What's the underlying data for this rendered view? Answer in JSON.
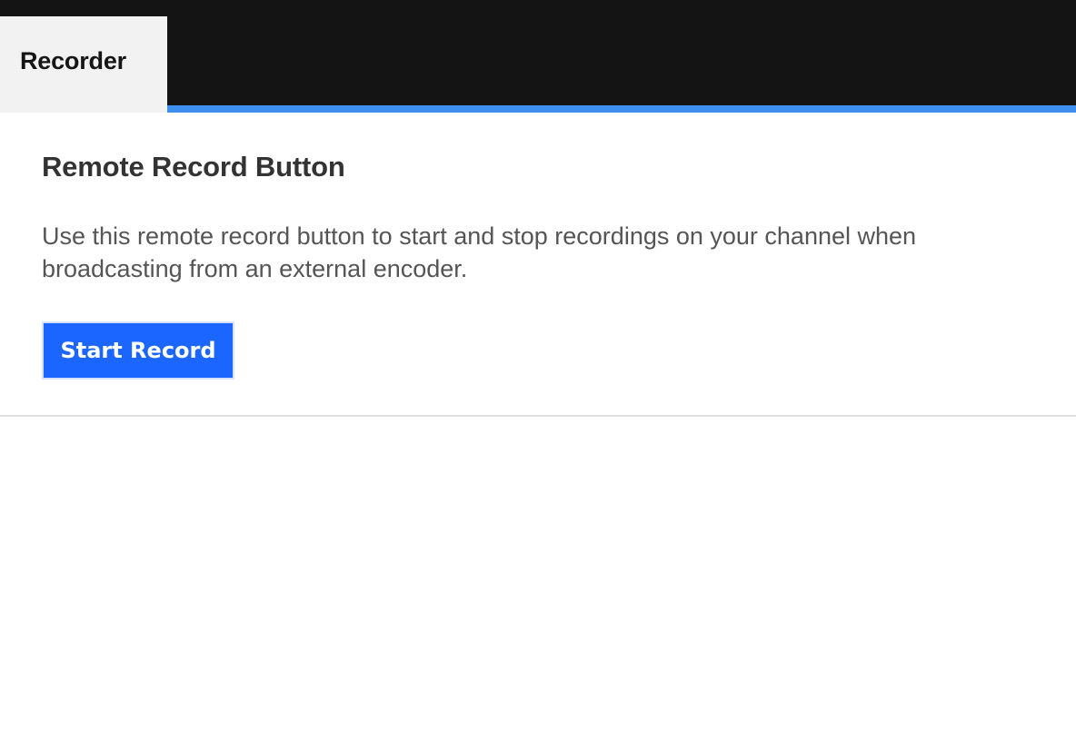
{
  "tabs": [
    {
      "label": "Recorder",
      "active": true
    }
  ],
  "recorder": {
    "title": "Remote Record Button",
    "description": "Use this remote record button to start and stop recordings on your channel when broadcasting from an external encoder.",
    "start_label": "Start Record"
  },
  "colors": {
    "topbar": "#141414",
    "tab_active_bg": "#f2f2f2",
    "accent_underline": "#3f8ff0",
    "button_primary": "#1a66ff"
  }
}
